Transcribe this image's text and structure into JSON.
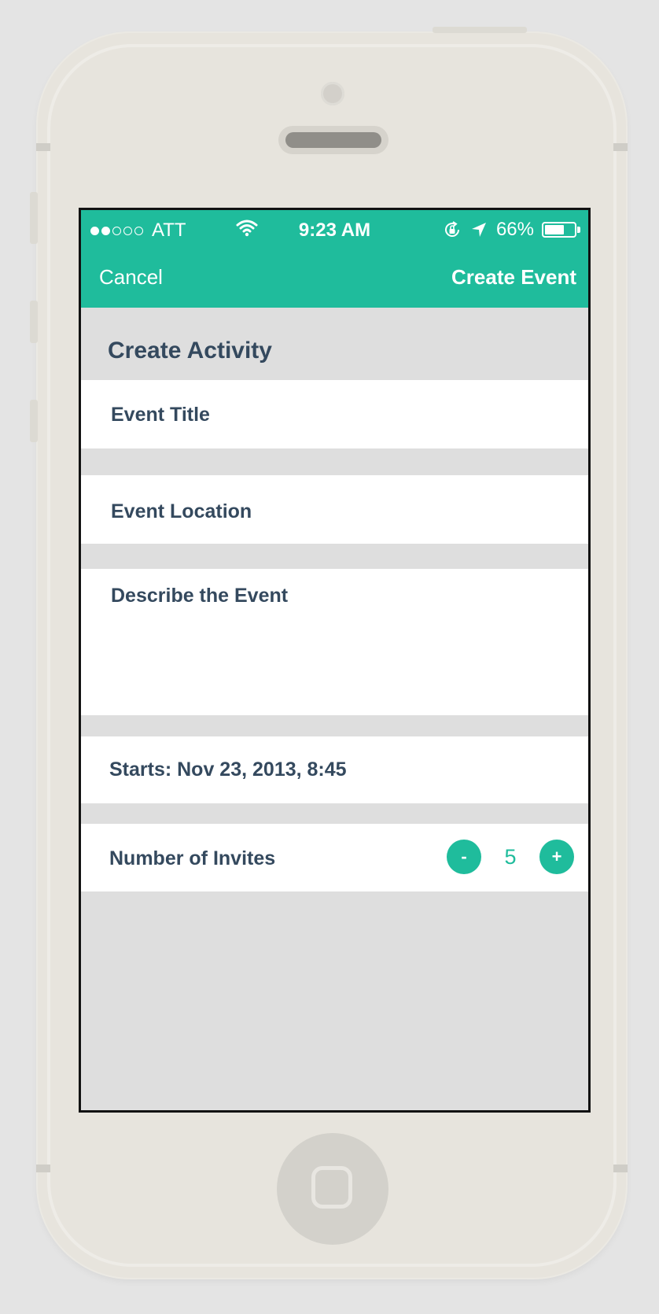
{
  "status_bar": {
    "carrier": "ATT",
    "signal_filled": 2,
    "signal_total": 5,
    "time": "9:23 AM",
    "battery_percent": "66%",
    "battery_level": 0.66,
    "icons": [
      "wifi-icon",
      "rotation-lock-icon",
      "location-arrow-icon",
      "battery-icon"
    ]
  },
  "nav": {
    "cancel_label": "Cancel",
    "create_label": "Create Event"
  },
  "form": {
    "section_title": "Create Activity",
    "title_placeholder": "Event Title",
    "location_placeholder": "Event Location",
    "description_placeholder": "Describe the Event",
    "starts_label": "Starts: Nov 23, 2013, 8:45",
    "invites_label": "Number of Invites",
    "invites_count": "5",
    "decrement_label": "-",
    "increment_label": "+"
  },
  "colors": {
    "accent": "#1fbc9c",
    "text": "#34495e",
    "background": "#dedede"
  }
}
